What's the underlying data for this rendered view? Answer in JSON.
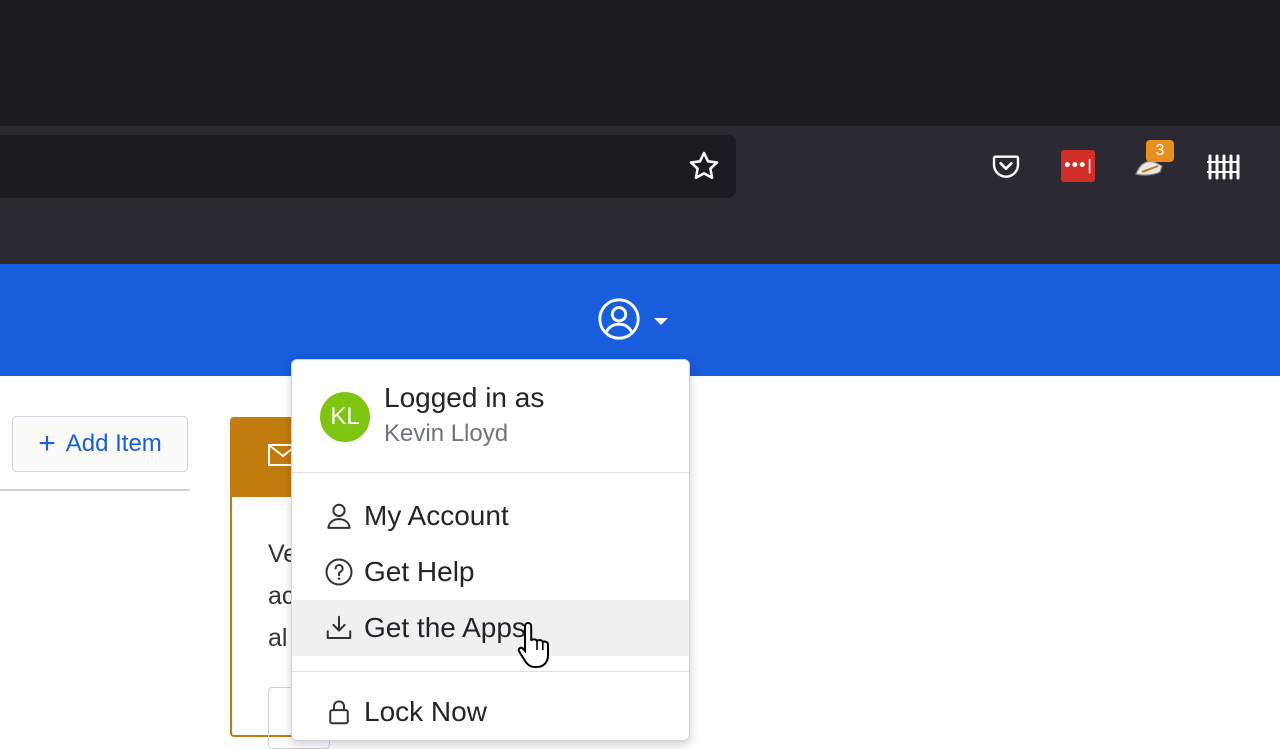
{
  "browser": {
    "bookmark_icon": "star-icon",
    "toolbar_icons": [
      "pocket-icon",
      "lastpass-icon",
      "extension-icon",
      "library-icon"
    ],
    "lastpass_label": "•••|",
    "extension_badge": "3"
  },
  "header": {
    "color": "#175ddc",
    "profile_icon": "user-circle-icon"
  },
  "toolbar": {
    "add_item_label": "Add Item"
  },
  "card": {
    "accent": "#c27c0e",
    "lines": [
      "Ve",
      "ac",
      "al"
    ]
  },
  "profile_menu": {
    "logged_in_label": "Logged in as",
    "user_name": "Kevin Lloyd",
    "avatar_initials": "KL",
    "avatar_color": "#7dc50e",
    "items": [
      {
        "label": "My Account",
        "icon": "user-icon"
      },
      {
        "label": "Get Help",
        "icon": "question-circle-icon"
      },
      {
        "label": "Get the Apps",
        "icon": "download-icon",
        "hovered": true
      },
      {
        "label": "Lock Now",
        "icon": "lock-icon"
      }
    ]
  }
}
